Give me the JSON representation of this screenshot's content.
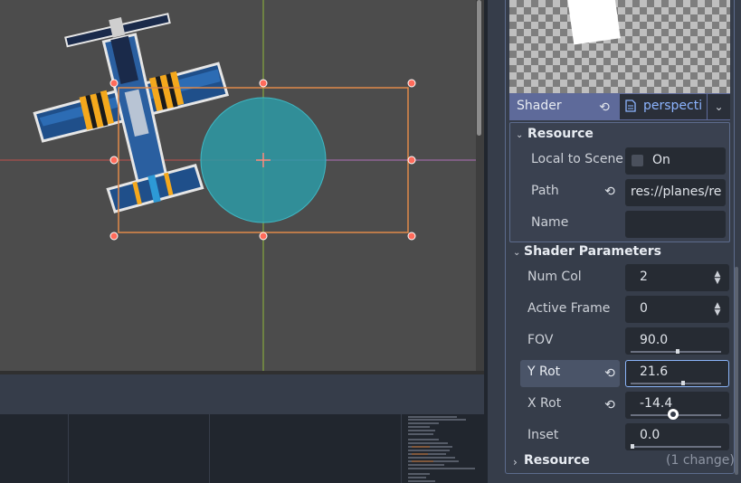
{
  "inspector": {
    "shader": {
      "label": "Shader",
      "value": "perspecti",
      "file_icon": "file-icon"
    },
    "resource_section": {
      "title": "Resource",
      "local_to_scene": {
        "label": "Local to Scene",
        "value": "On",
        "checked": false
      },
      "path": {
        "label": "Path",
        "value": "res://planes/re"
      },
      "name": {
        "label": "Name",
        "value": ""
      }
    },
    "shader_parameters": {
      "title": "Shader Parameters",
      "num_col": {
        "label": "Num Col",
        "value": "2"
      },
      "active_frame": {
        "label": "Active Frame",
        "value": "0"
      },
      "fov": {
        "label": "FOV",
        "value": "90.0",
        "fraction": 0.5
      },
      "y_rot": {
        "label": "Y Rot",
        "value": "21.6",
        "fraction": 0.56
      },
      "x_rot": {
        "label": "X Rot",
        "value": "-14.4",
        "fraction": 0.47
      },
      "inset": {
        "label": "Inset",
        "value": "0.0",
        "fraction": 0.0
      }
    },
    "bottom_resource": {
      "title": "Resource",
      "changes": "(1 change)"
    }
  },
  "colors": {
    "viewport_bg": "#4c4c4c",
    "selection_rect": "#e08a4a",
    "handle": "#ff6b5b",
    "collision_circle": "#2d9aa6",
    "accent": "#8ab4f8",
    "shader_row": "#5e6a9a"
  },
  "icons": [
    "revert-icon",
    "file-icon",
    "chevron-down-icon",
    "chevron-right-icon",
    "spin-arrows-icon",
    "crosshair-icon"
  ]
}
